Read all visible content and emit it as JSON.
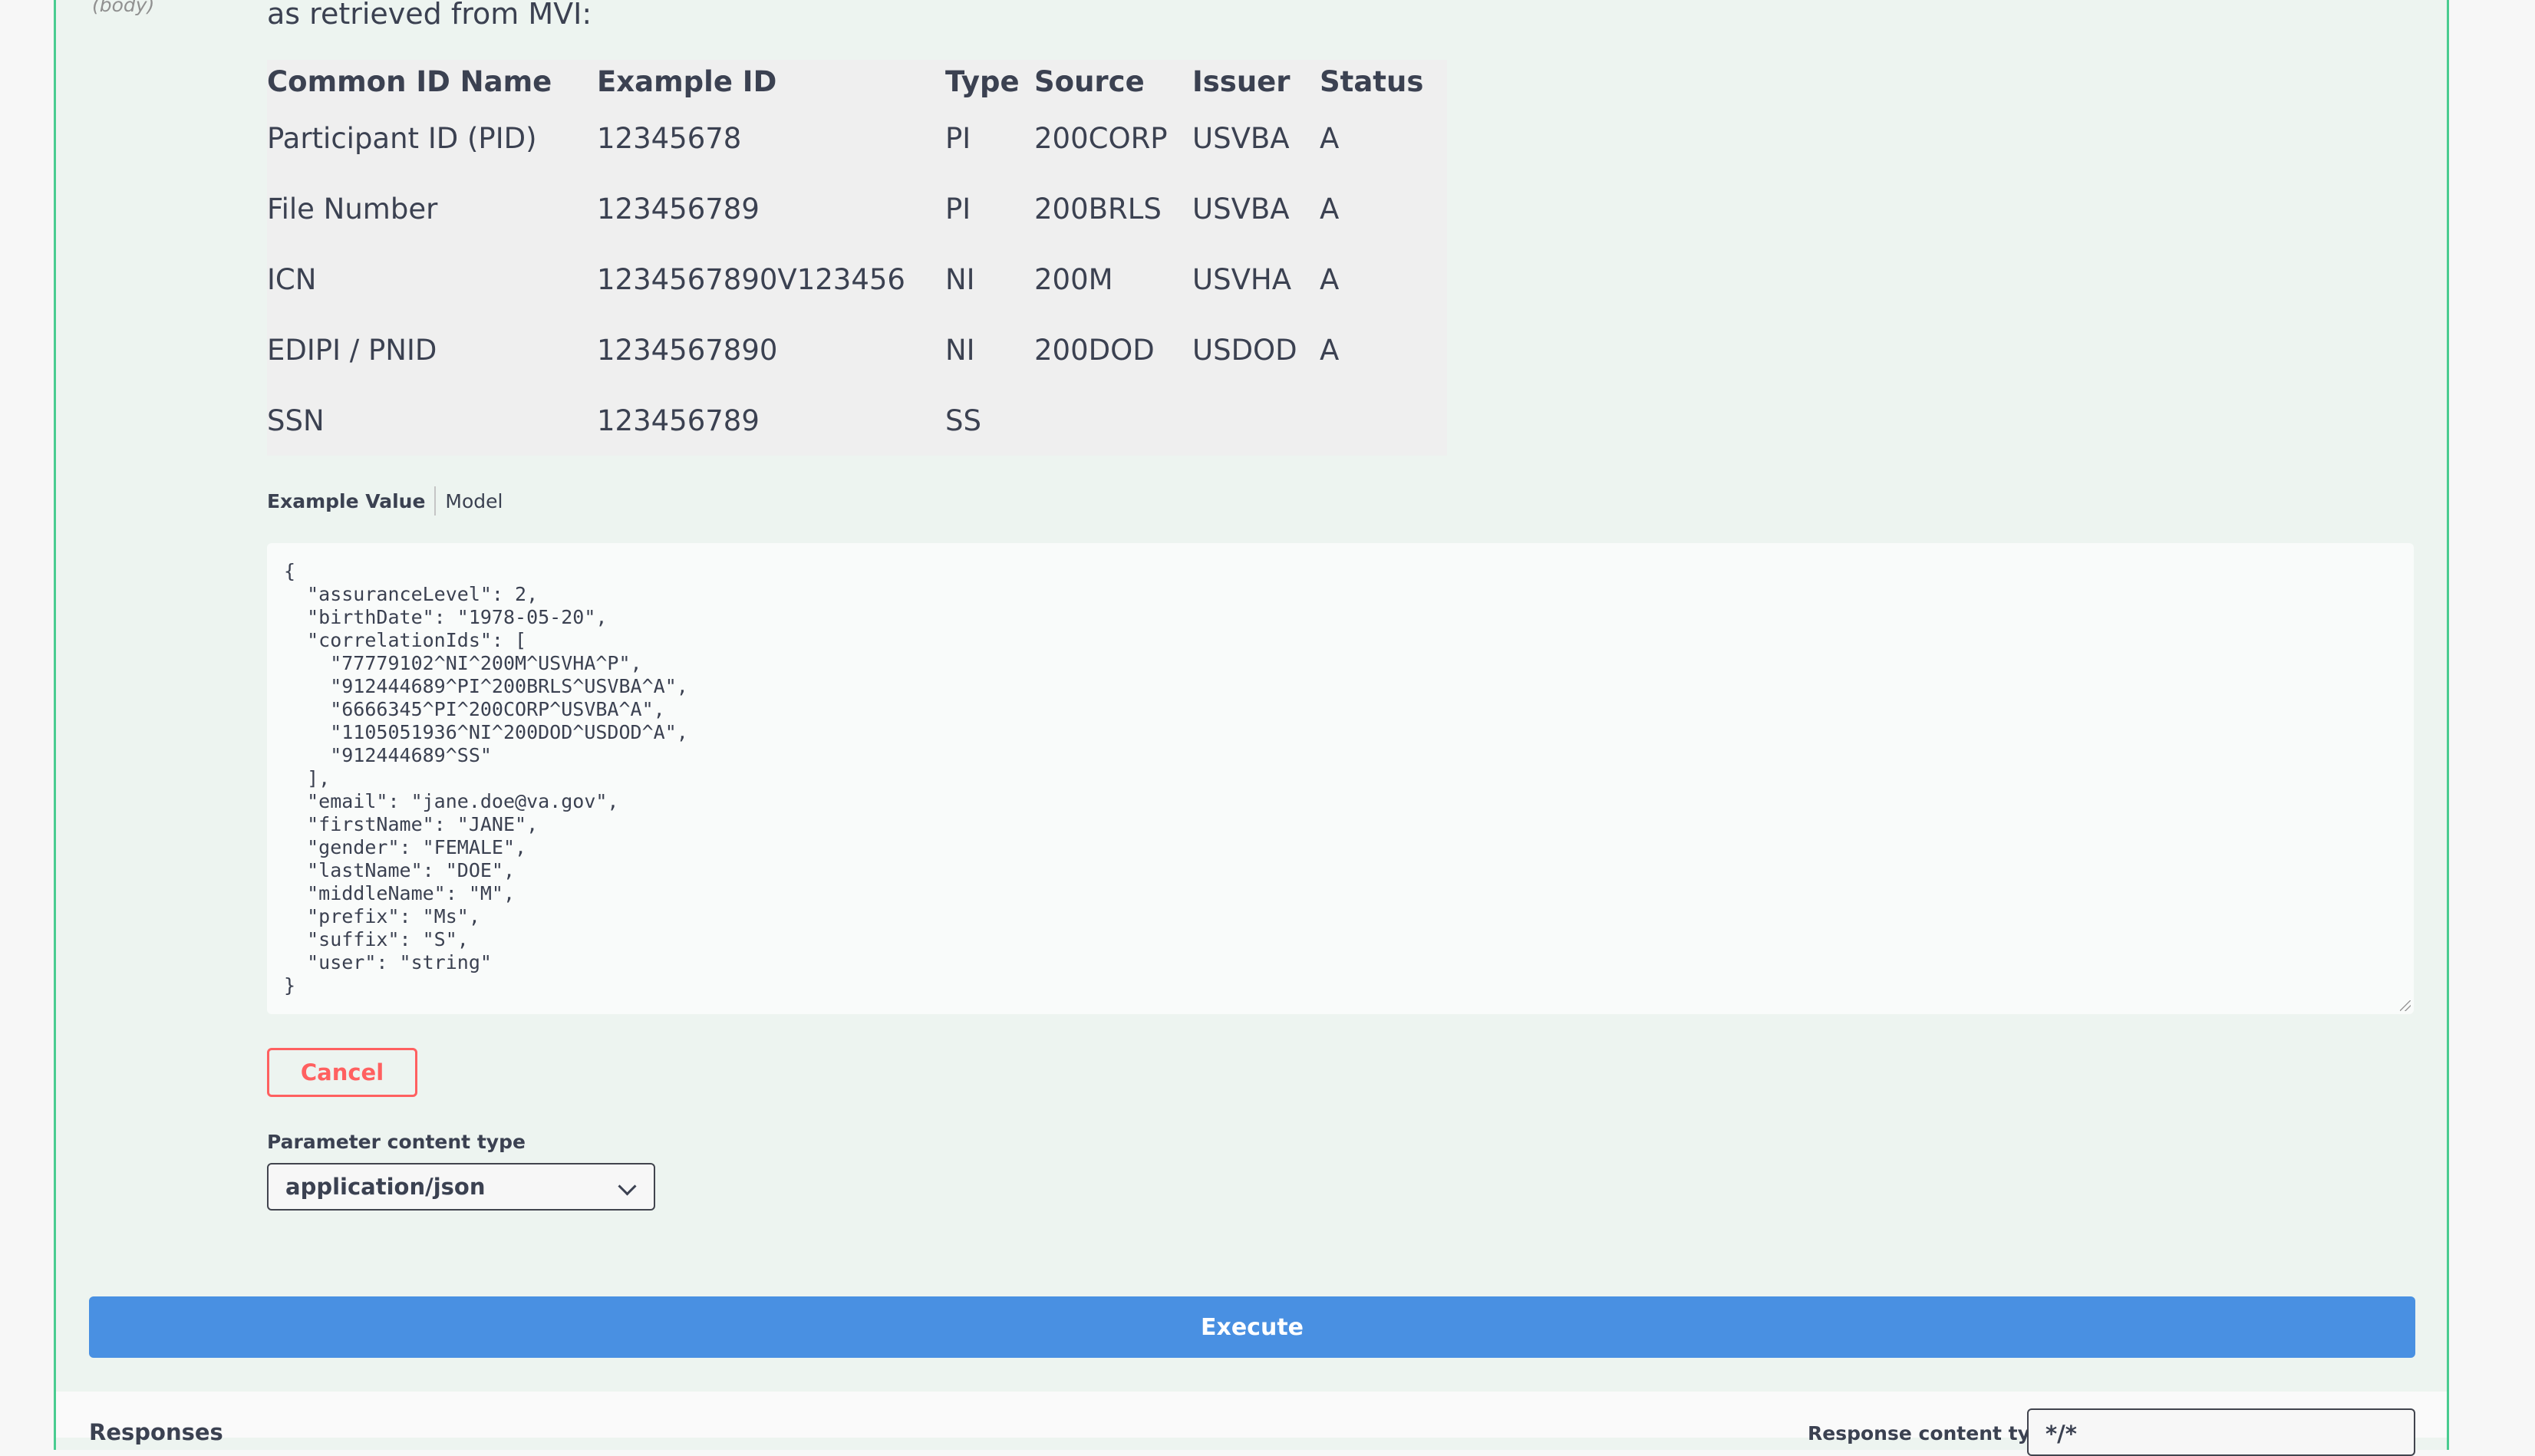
{
  "parameter": {
    "in_label": "(body)",
    "description_tail": "as retrieved from MVI:"
  },
  "id_table": {
    "headers": [
      "Common ID Name",
      "Example ID",
      "Type",
      "Source",
      "Issuer",
      "Status"
    ],
    "rows": [
      [
        "Participant ID (PID)",
        "12345678",
        "PI",
        "200CORP",
        "USVBA",
        "A"
      ],
      [
        "File Number",
        "123456789",
        "PI",
        "200BRLS",
        "USVBA",
        "A"
      ],
      [
        "ICN",
        "1234567890V123456",
        "NI",
        "200M",
        "USVHA",
        "A"
      ],
      [
        "EDIPI / PNID",
        "1234567890",
        "NI",
        "200DOD",
        "USDOD",
        "A"
      ],
      [
        "SSN",
        "123456789",
        "SS",
        "",
        "",
        ""
      ]
    ]
  },
  "tabs": {
    "example_value": "Example Value",
    "model": "Model"
  },
  "body_example": "{\n  \"assuranceLevel\": 2,\n  \"birthDate\": \"1978-05-20\",\n  \"correlationIds\": [\n    \"77779102^NI^200M^USVHA^P\",\n    \"912444689^PI^200BRLS^USVBA^A\",\n    \"6666345^PI^200CORP^USVBA^A\",\n    \"1105051936^NI^200DOD^USDOD^A\",\n    \"912444689^SS\"\n  ],\n  \"email\": \"jane.doe@va.gov\",\n  \"firstName\": \"JANE\",\n  \"gender\": \"FEMALE\",\n  \"lastName\": \"DOE\",\n  \"middleName\": \"M\",\n  \"prefix\": \"Ms\",\n  \"suffix\": \"S\",\n  \"user\": \"string\"\n}",
  "cancel_label": "Cancel",
  "parameter_content_type": {
    "label": "Parameter content type",
    "value": "application/json"
  },
  "execute_label": "Execute",
  "responses": {
    "title": "Responses",
    "content_type_label": "Response content type",
    "content_type_value": "*/*"
  },
  "colors": {
    "panel_bg": "#edf4f0",
    "panel_border": "#49cc90",
    "execute_bg": "#4990e2",
    "cancel": "#ff6060"
  }
}
